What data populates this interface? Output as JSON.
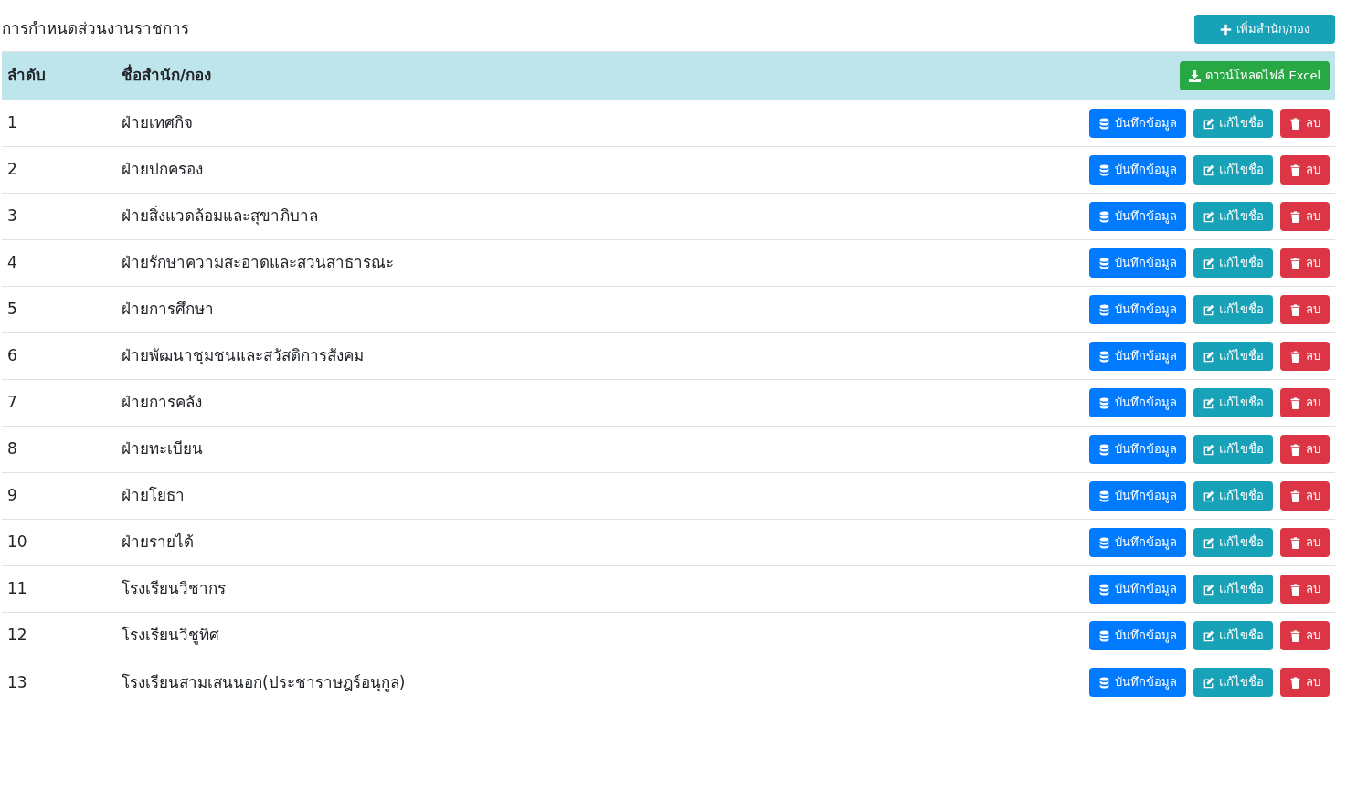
{
  "page_title": "การกำหนดส่วนงานราชการ",
  "add_button": {
    "label": "เพิ่มสำนัก/กอง",
    "kind": "add"
  },
  "table": {
    "columns": [
      "ลำดับ",
      "ชื่อสำนัก/กอง"
    ],
    "download_button": {
      "label": "ดาวน์โหลดไฟล์ Excel",
      "kind": "download"
    },
    "rows": [
      {
        "number": "1",
        "name": "ฝ่ายเทศกิจ",
        "actions": [
          {
            "kind": "save",
            "label": "บันทึกข้อมูล"
          },
          {
            "kind": "edit",
            "label": "แก้ไขชื่อ"
          },
          {
            "kind": "delete",
            "label": "ลบ"
          }
        ]
      },
      {
        "number": "2",
        "name": "ฝ่ายปกครอง",
        "actions": [
          {
            "kind": "save",
            "label": "บันทึกข้อมูล"
          },
          {
            "kind": "edit",
            "label": "แก้ไขชื่อ"
          },
          {
            "kind": "delete",
            "label": "ลบ"
          }
        ]
      },
      {
        "number": "3",
        "name": "ฝ่ายสิ่งแวดล้อมและสุขาภิบาล",
        "actions": [
          {
            "kind": "save",
            "label": "บันทึกข้อมูล"
          },
          {
            "kind": "edit",
            "label": "แก้ไขชื่อ"
          },
          {
            "kind": "delete",
            "label": "ลบ"
          }
        ]
      },
      {
        "number": "4",
        "name": "ฝ่ายรักษาความสะอาดและสวนสาธารณะ",
        "actions": [
          {
            "kind": "save",
            "label": "บันทึกข้อมูล"
          },
          {
            "kind": "edit",
            "label": "แก้ไขชื่อ"
          },
          {
            "kind": "delete",
            "label": "ลบ"
          }
        ]
      },
      {
        "number": "5",
        "name": "ฝ่ายการศึกษา",
        "actions": [
          {
            "kind": "save",
            "label": "บันทึกข้อมูล"
          },
          {
            "kind": "edit",
            "label": "แก้ไขชื่อ"
          },
          {
            "kind": "delete",
            "label": "ลบ"
          }
        ]
      },
      {
        "number": "6",
        "name": "ฝ่ายพัฒนาชุมชนและสวัสดิการสังคม",
        "actions": [
          {
            "kind": "save",
            "label": "บันทึกข้อมูล"
          },
          {
            "kind": "edit",
            "label": "แก้ไขชื่อ"
          },
          {
            "kind": "delete",
            "label": "ลบ"
          }
        ]
      },
      {
        "number": "7",
        "name": "ฝ่ายการคลัง",
        "actions": [
          {
            "kind": "save",
            "label": "บันทึกข้อมูล"
          },
          {
            "kind": "edit",
            "label": "แก้ไขชื่อ"
          },
          {
            "kind": "delete",
            "label": "ลบ"
          }
        ]
      },
      {
        "number": "8",
        "name": "ฝ่ายทะเบียน",
        "actions": [
          {
            "kind": "save",
            "label": "บันทึกข้อมูล"
          },
          {
            "kind": "edit",
            "label": "แก้ไขชื่อ"
          },
          {
            "kind": "delete",
            "label": "ลบ"
          }
        ]
      },
      {
        "number": "9",
        "name": "ฝ่ายโยธา",
        "actions": [
          {
            "kind": "save",
            "label": "บันทึกข้อมูล"
          },
          {
            "kind": "edit",
            "label": "แก้ไขชื่อ"
          },
          {
            "kind": "delete",
            "label": "ลบ"
          }
        ]
      },
      {
        "number": "10",
        "name": "ฝ่ายรายได้",
        "actions": [
          {
            "kind": "save",
            "label": "บันทึกข้อมูล"
          },
          {
            "kind": "edit",
            "label": "แก้ไขชื่อ"
          },
          {
            "kind": "delete",
            "label": "ลบ"
          }
        ]
      },
      {
        "number": "11",
        "name": "โรงเรียนวิชากร",
        "actions": [
          {
            "kind": "save",
            "label": "บันทึกข้อมูล"
          },
          {
            "kind": "edit",
            "label": "แก้ไขชื่อ"
          },
          {
            "kind": "delete",
            "label": "ลบ"
          }
        ]
      },
      {
        "number": "12",
        "name": "โรงเรียนวิชูทิศ",
        "actions": [
          {
            "kind": "save",
            "label": "บันทึกข้อมูล"
          },
          {
            "kind": "edit",
            "label": "แก้ไขชื่อ"
          },
          {
            "kind": "delete",
            "label": "ลบ"
          }
        ]
      },
      {
        "number": "13",
        "name": "โรงเรียนสามเสนนอก(ประชาราษฎร์อนุกูล)",
        "actions": [
          {
            "kind": "save",
            "label": "บันทึกข้อมูล"
          },
          {
            "kind": "edit",
            "label": "แก้ไขชื่อ"
          },
          {
            "kind": "delete",
            "label": "ลบ"
          }
        ]
      }
    ]
  }
}
